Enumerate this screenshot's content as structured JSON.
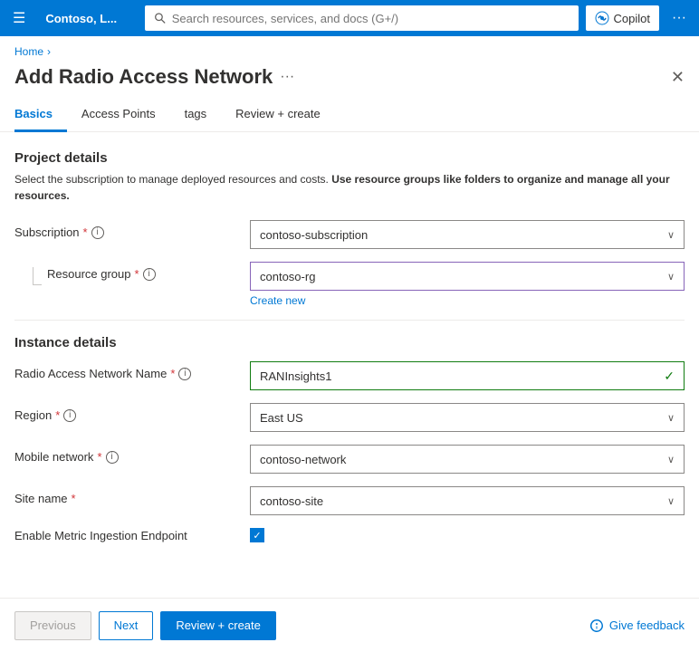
{
  "topnav": {
    "hamburger_label": "☰",
    "tenant": "Contoso, L...",
    "search_placeholder": "Search resources, services, and docs (G+/)",
    "copilot_label": "Copilot",
    "more_label": "···"
  },
  "breadcrumb": {
    "home": "Home",
    "separator": "›"
  },
  "page": {
    "title": "Add Radio Access Network",
    "ellipsis": "···",
    "close": "✕"
  },
  "tabs": [
    {
      "id": "basics",
      "label": "Basics",
      "active": true
    },
    {
      "id": "access-points",
      "label": "Access Points",
      "active": false
    },
    {
      "id": "tags",
      "label": "tags",
      "active": false
    },
    {
      "id": "review-create",
      "label": "Review + create",
      "active": false
    }
  ],
  "sections": {
    "project_details": {
      "title": "Project details",
      "description_start": "Select the subscription to manage deployed resources and costs. ",
      "description_bold": "Use resource groups like folders to organize and manage all your resources.",
      "subscription_label": "Subscription",
      "subscription_required": "*",
      "subscription_value": "contoso-subscription",
      "resource_group_label": "Resource group",
      "resource_group_required": "*",
      "resource_group_value": "contoso-rg",
      "create_new": "Create new"
    },
    "instance_details": {
      "title": "Instance details",
      "ran_name_label": "Radio Access Network Name",
      "ran_name_required": "*",
      "ran_name_value": "RANInsights1",
      "region_label": "Region",
      "region_required": "*",
      "region_value": "East US",
      "mobile_network_label": "Mobile network",
      "mobile_network_required": "*",
      "mobile_network_value": "contoso-network",
      "site_name_label": "Site name",
      "site_name_required": "*",
      "site_name_value": "contoso-site",
      "enable_metric_label": "Enable Metric Ingestion Endpoint"
    }
  },
  "footer": {
    "previous_label": "Previous",
    "next_label": "Next",
    "review_create_label": "Review + create",
    "give_feedback_label": "Give feedback"
  }
}
